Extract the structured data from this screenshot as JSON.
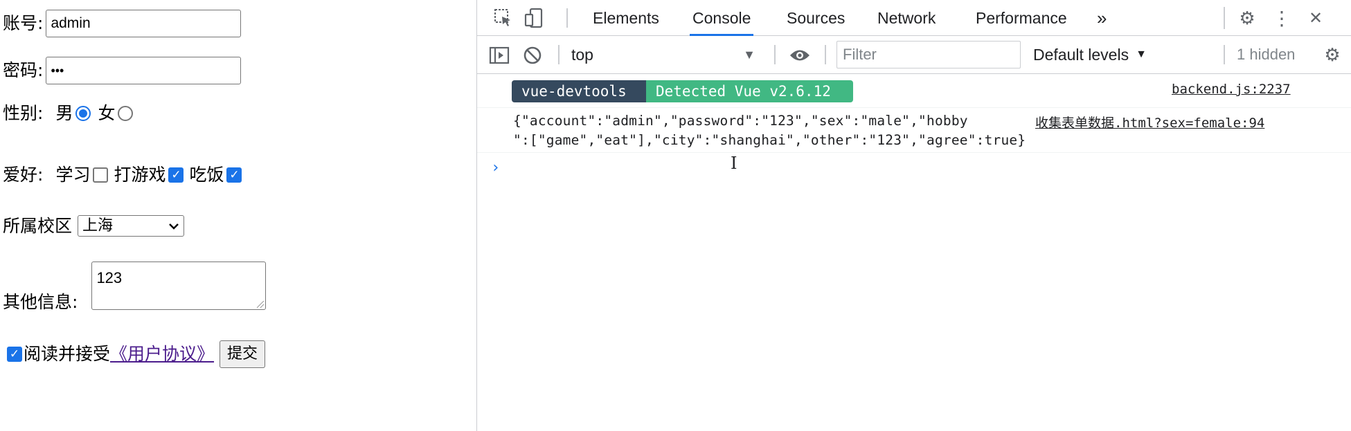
{
  "form": {
    "account_label": "账号:",
    "account_value": "admin",
    "password_label": "密码:",
    "password_value": "•••",
    "sex_label": "性别:",
    "sex_male_label": "男",
    "sex_female_label": "女",
    "hobby_label": "爱好:",
    "hobby_study_label": "学习",
    "hobby_game_label": "打游戏",
    "hobby_eat_label": "吃饭",
    "checkmark": "✓",
    "city_label": "所属校区",
    "city_selected": "上海",
    "other_label": "其他信息:",
    "other_value": "123",
    "agree_text": "阅读并接受",
    "agree_link": "《用户协议》",
    "submit_label": "提交"
  },
  "devtools": {
    "tabs": [
      {
        "label": "Elements"
      },
      {
        "label": "Console"
      },
      {
        "label": "Sources"
      },
      {
        "label": "Network"
      },
      {
        "label": "Performance"
      }
    ],
    "more_tabs": "»",
    "settings_icon": "⚙",
    "more_icon": "⋮",
    "close_icon": "✕",
    "context": "top",
    "context_arrow": "▼",
    "filter_placeholder": "Filter",
    "levels_label": "Default levels",
    "levels_arrow": "▼",
    "hidden_count": "1 hidden",
    "messages": {
      "vue_badge_left": "vue-devtools",
      "vue_badge_right": "Detected Vue v2.6.12",
      "vue_source": "backend.js:2237",
      "log_line1": "{\"account\":\"admin\",\"password\":\"123\",\"sex\":\"male\",\"hobby",
      "log_line2": "\":[\"game\",\"eat\"],\"city\":\"shanghai\",\"other\":\"123\",\"agree\":true}",
      "log_source": "收集表单数据.html?sex=female:94",
      "prompt": "›",
      "text_cursor": "I"
    }
  }
}
